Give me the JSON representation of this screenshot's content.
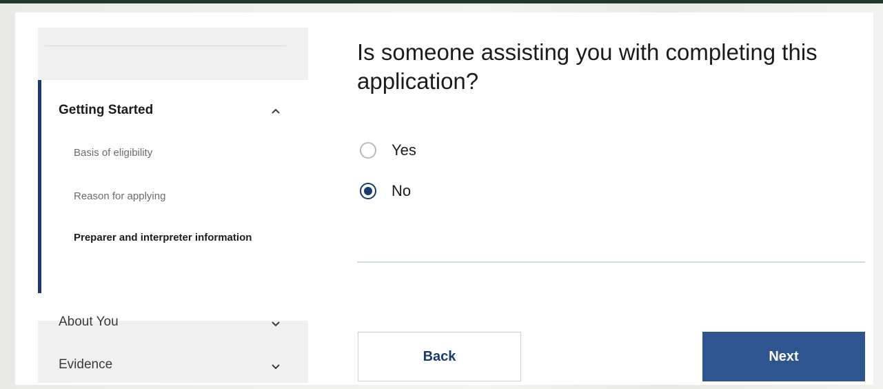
{
  "sidebar": {
    "sections": [
      {
        "title": "Getting Started",
        "expanded": true,
        "items": [
          {
            "label": "Basis of eligibility"
          },
          {
            "label": "Reason for applying"
          },
          {
            "label": "Preparer and interpreter information",
            "current": true
          }
        ]
      },
      {
        "title": "About You",
        "expanded": false
      },
      {
        "title": "Evidence",
        "expanded": false
      }
    ]
  },
  "main": {
    "question": "Is someone assisting you with completing this application?",
    "options": [
      {
        "label": "Yes",
        "selected": false
      },
      {
        "label": "No",
        "selected": true
      }
    ],
    "back_label": "Back",
    "next_label": "Next"
  },
  "colors": {
    "accent": "#1a3a6e",
    "next_button": "#2e5590",
    "divider": "#c9dedd"
  },
  "icons": {
    "expanded": "chevron-up-icon",
    "collapsed": "chevron-down-icon"
  }
}
